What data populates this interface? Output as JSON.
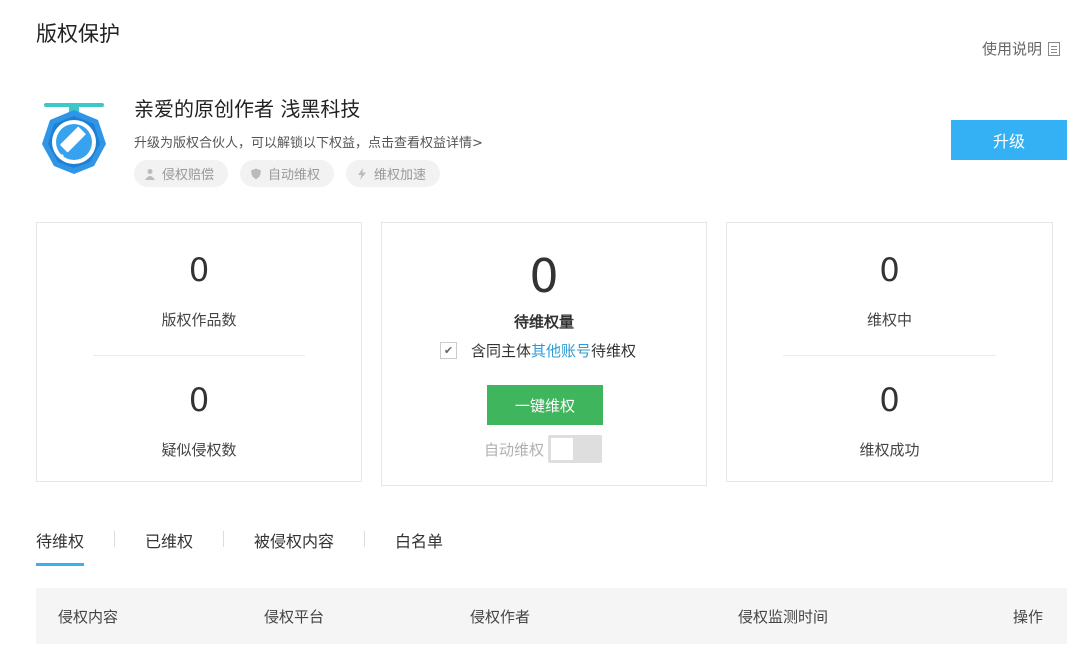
{
  "page": {
    "title": "版权保护"
  },
  "help": {
    "label": "使用说明",
    "icon": "document-list-icon"
  },
  "profile": {
    "greeting": "亲爱的原创作者 浅黑科技",
    "upgrade_hint": "升级为版权合伙人，可以解锁以下权益，点击查看权益详情>",
    "avatar_icon": "pen-badge-icon",
    "tags": [
      {
        "label": "侵权赔偿",
        "icon": "person-icon"
      },
      {
        "label": "自动维权",
        "icon": "shield-icon"
      },
      {
        "label": "维权加速",
        "icon": "lightning-icon"
      }
    ],
    "upgrade_button": "升级"
  },
  "stats": {
    "works_count": "0",
    "works_label": "版权作品数",
    "suspected_count": "0",
    "suspected_label": "疑似侵权数",
    "pending_count": "0",
    "pending_label": "待维权量",
    "include_prefix": "含同主体",
    "include_link": "其他账号",
    "include_suffix": "待维权",
    "include_checked": true,
    "one_click_button": "一键维权",
    "auto_label": "自动维权",
    "auto_enabled": false,
    "in_progress_count": "0",
    "in_progress_label": "维权中",
    "success_count": "0",
    "success_label": "维权成功"
  },
  "tabs": [
    {
      "label": "待维权",
      "active": true
    },
    {
      "label": "已维权",
      "active": false
    },
    {
      "label": "被侵权内容",
      "active": false
    },
    {
      "label": "白名单",
      "active": false
    }
  ],
  "table": {
    "columns": [
      "侵权内容",
      "侵权平台",
      "侵权作者",
      "侵权监测时间",
      "操作"
    ]
  },
  "colors": {
    "accent_blue": "#34b1f5",
    "action_green": "#3fb65d",
    "link_blue": "#2e9bd6"
  }
}
